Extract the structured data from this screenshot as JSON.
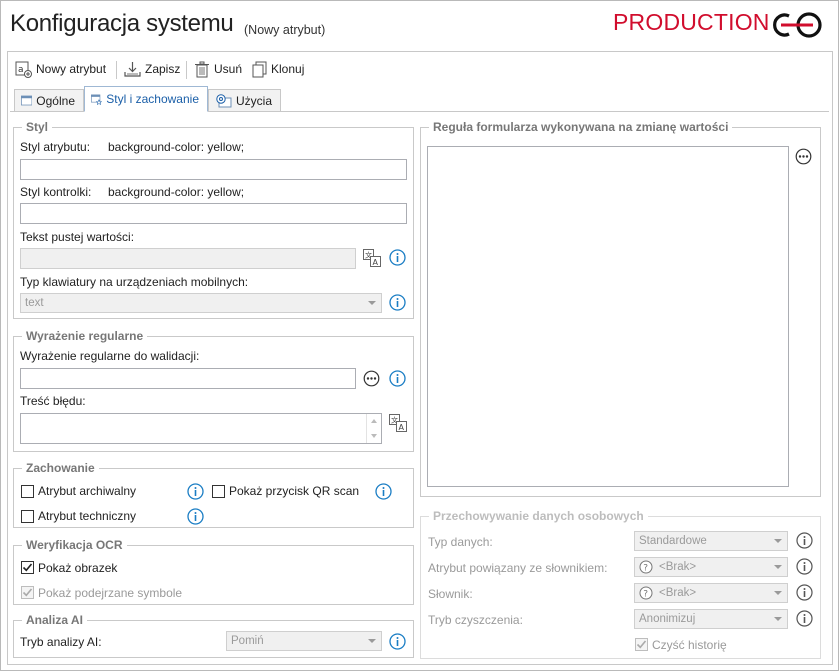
{
  "header": {
    "title": "Konfiguracja systemu",
    "subtitle": "(Nowy atrybut)",
    "environment": "PRODUCTION",
    "environment_color": "#d10d2d",
    "logo_icon": "production-logo-icon"
  },
  "toolbar": {
    "new_label": "Nowy atrybut",
    "save_label": "Zapisz",
    "delete_label": "Usuń",
    "clone_label": "Klonuj"
  },
  "tabs": [
    {
      "label": "Ogólne",
      "icon": "window-icon"
    },
    {
      "label": "Styl i zachowanie",
      "icon": "style-window-icon",
      "active": true
    },
    {
      "label": "Użycia",
      "icon": "usage-icon"
    }
  ],
  "style_group": {
    "title": "Styl",
    "attr_style_label": "Styl atrybutu:",
    "attr_style_value": "background-color: yellow;",
    "control_style_label": "Styl kontrolki:",
    "control_style_value": "background-color: yellow;",
    "empty_text_label": "Tekst pustej wartości:",
    "keyboard_label": "Typ klawiatury na urządzeniach mobilnych:",
    "keyboard_value": "text"
  },
  "regex_group": {
    "title": "Wyrażenie regularne",
    "regex_label": "Wyrażenie regularne do walidacji:",
    "error_label": "Treść błędu:"
  },
  "behavior_group": {
    "title": "Zachowanie",
    "archival_label": "Atrybut archiwalny",
    "qr_label": "Pokaż przycisk QR scan",
    "technical_label": "Atrybut techniczny"
  },
  "ocr_group": {
    "title": "Weryfikacja OCR",
    "show_image_label": "Pokaż obrazek",
    "show_suspect_label": "Pokaż podejrzane symbole"
  },
  "ai_group": {
    "title": "Analiza AI",
    "mode_label": "Tryb analizy AI:",
    "mode_value": "Pomiń"
  },
  "rule_group": {
    "title": "Reguła formularza wykonywana na zmianę wartości"
  },
  "personal_data_group": {
    "title": "Przechowywanie danych osobowych",
    "data_type_label": "Typ danych:",
    "data_type_value": "Standardowe",
    "linked_attr_label": "Atrybut powiązany ze słownikiem:",
    "linked_attr_value": "<Brak>",
    "dictionary_label": "Słownik:",
    "dictionary_value": "<Brak>",
    "cleanup_mode_label": "Tryb czyszczenia:",
    "cleanup_mode_value": "Anonimizuj",
    "clear_history_label": "Czyść historię"
  },
  "colors": {
    "accent": "#1b5fa8",
    "info_icon": "#1a7dc4"
  }
}
